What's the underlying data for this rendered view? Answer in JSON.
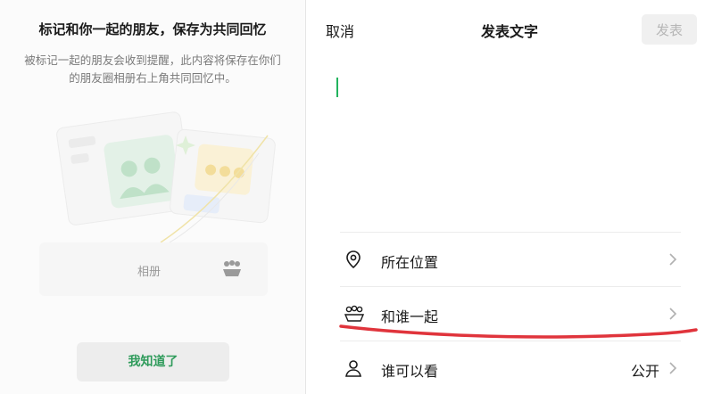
{
  "left_panel": {
    "title": "标记和你一起的朋友，保存为共同回忆",
    "description": "被标记一起的朋友会收到提醒，此内容将保存在你们的朋友圈相册右上角共同回忆中。",
    "album_label": "相册",
    "confirm_button": "我知道了"
  },
  "header": {
    "cancel": "取消",
    "title": "发表文字",
    "publish": "发表"
  },
  "options": [
    {
      "icon": "location-pin-icon",
      "label": "所在位置",
      "value": ""
    },
    {
      "icon": "people-group-icon",
      "label": "和谁一起",
      "value": ""
    },
    {
      "icon": "person-icon",
      "label": "谁可以看",
      "value": "公开"
    }
  ],
  "colors": {
    "accent_green": "#2f9b5b",
    "caret_green": "#22b35e",
    "annotation_red": "#e0343c",
    "disabled_text": "#b6b6b6"
  }
}
